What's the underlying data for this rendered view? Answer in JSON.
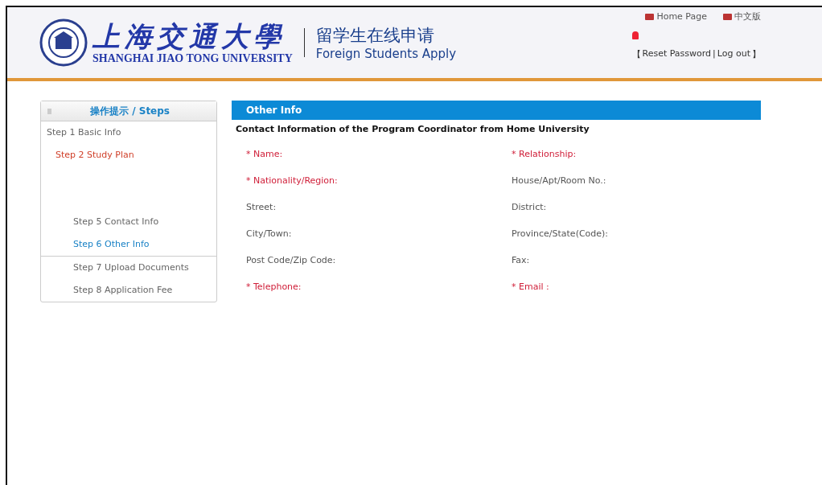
{
  "header": {
    "logo_cn": "上海交通大學",
    "logo_en": "SHANGHAI JIAO TONG UNIVERSITY",
    "app_cn": "留学生在线申请",
    "app_en": "Foreign Students Apply",
    "links": [
      {
        "label": "Home Page"
      },
      {
        "label": "中文版"
      }
    ],
    "account_links": [
      "【",
      "Reset Password",
      "|",
      "Log out",
      "】"
    ]
  },
  "sidebar": {
    "title": "操作提示 / Steps",
    "items": [
      {
        "label": "Step 1 Basic Info",
        "selected": false
      },
      {
        "label": "Step 2 Study Plan",
        "selected": false
      },
      {
        "label": "Step 5 Contact Info",
        "selected": false
      },
      {
        "label": "Step 6 Other Info",
        "selected": true
      },
      {
        "label": "Step 7 Upload Documents",
        "selected": false
      },
      {
        "label": "Step 8 Application Fee",
        "selected": false
      }
    ]
  },
  "panel": {
    "title": "Other Info",
    "section": "Contact Information of the Program Coordinator from Home University",
    "fields": [
      {
        "label": "* Name:",
        "required": true
      },
      {
        "label": "* Relationship:",
        "required": true
      },
      {
        "label": "* Nationality/Region:",
        "required": true
      },
      {
        "label": "House/Apt/Room No.:",
        "required": false
      },
      {
        "label": "Street:",
        "required": false
      },
      {
        "label": "District:",
        "required": false
      },
      {
        "label": "City/Town:",
        "required": false
      },
      {
        "label": "Province/State(Code):",
        "required": false
      },
      {
        "label": "Post Code/Zip Code:",
        "required": false
      },
      {
        "label": "Fax:",
        "required": false
      },
      {
        "label": "* Telephone:",
        "required": true
      },
      {
        "label": "* Email :",
        "required": true
      }
    ]
  }
}
